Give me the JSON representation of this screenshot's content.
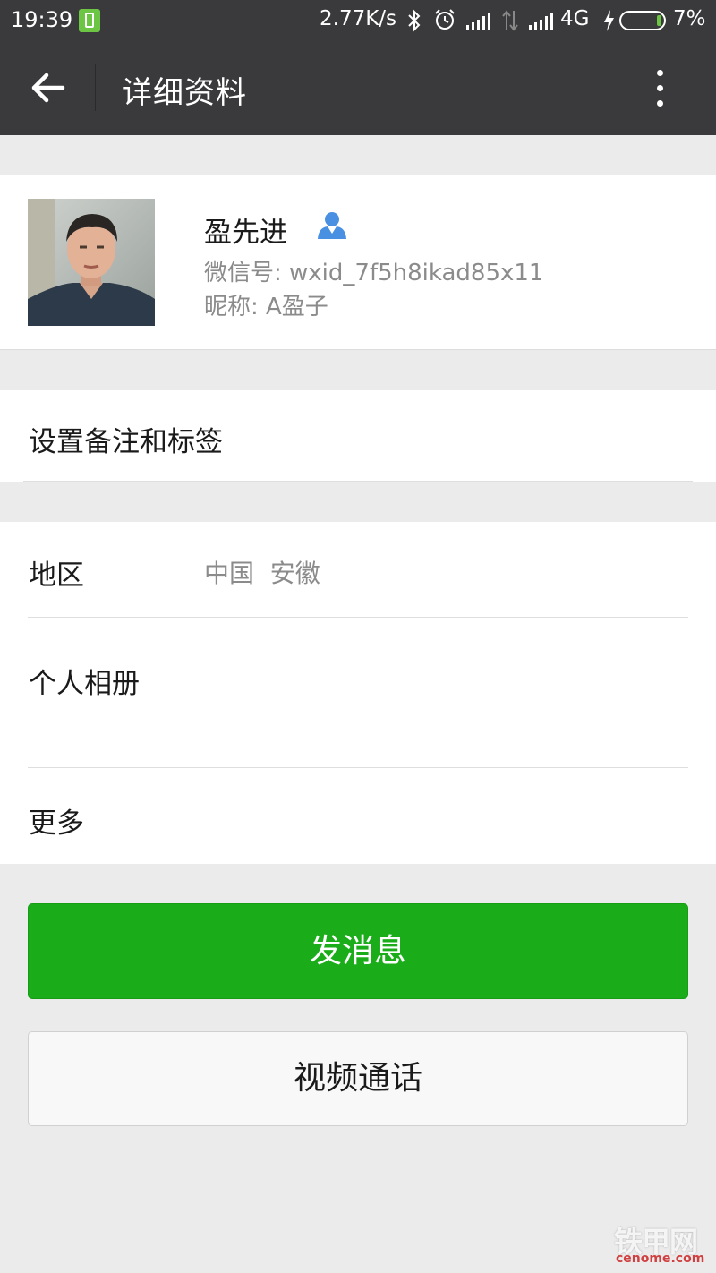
{
  "status_bar": {
    "time": "19:39",
    "network_speed": "2.77K/s",
    "network_type": "4G",
    "battery": "7%",
    "icons": [
      "phone-battery-app-icon",
      "bluetooth-icon",
      "alarm-icon",
      "signal-icon",
      "data-arrows-icon",
      "signal-icon",
      "charging-icon",
      "battery-icon"
    ]
  },
  "nav": {
    "title": "详细资料",
    "back_icon": "arrow-left-icon",
    "more_icon": "more-vertical-icon"
  },
  "profile": {
    "name": "盈先进",
    "wechat_id": "微信号: wxid_7f5h8ikad85x11",
    "nickname": "昵称: A盈子",
    "contact_icon": "contact-person-icon"
  },
  "rows": {
    "remark_tags": "设置备注和标签",
    "region_label": "地区",
    "region_value": "中国  安徽",
    "album": "个人相册",
    "more": "更多"
  },
  "buttons": {
    "send_message": "发消息",
    "video_call": "视频通话"
  },
  "watermark": {
    "logo_text": "铁甲网",
    "url": "cenome.com"
  },
  "colors": {
    "nav_bg": "#3a3a3c",
    "page_bg": "#ebebeb",
    "primary_green": "#1aad19",
    "secondary_text": "#8b8b8b",
    "contact_icon_blue": "#4a90e2"
  }
}
